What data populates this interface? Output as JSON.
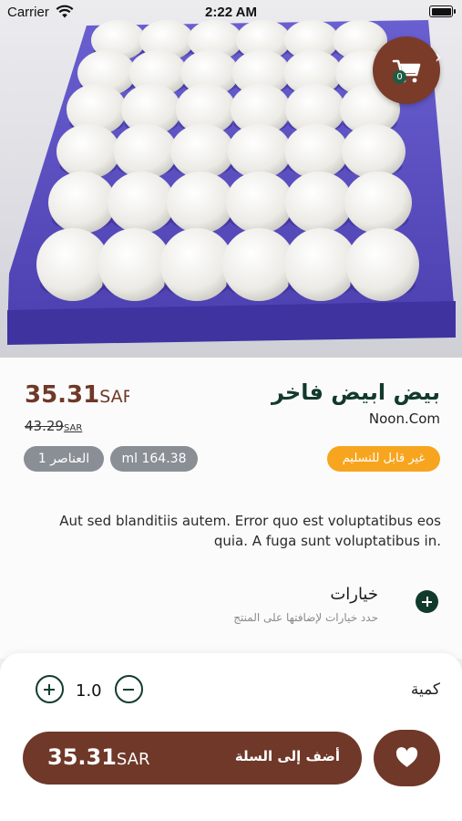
{
  "status_bar": {
    "carrier": "Carrier",
    "time": "2:22 AM"
  },
  "cart": {
    "count": "0"
  },
  "product": {
    "title": "بيض ابيض فاخر",
    "seller": "Noon.Com",
    "price": "35.31",
    "old_price": "43.29",
    "currency": "SAR",
    "delivery_badge": "غير قابل للتسليم",
    "weight_chip": "ml 164.38",
    "count_chip": "1 العناصر",
    "description": "Aut sed blanditiis autem. Error quo est voluptatibus eos quia. A fuga sunt voluptatibus in."
  },
  "options": {
    "title": "خيارات",
    "subtitle": "حدد خيارات لإضافتها على المنتج"
  },
  "quantity": {
    "label": "كمية",
    "value": "1.0"
  },
  "add_to_cart": {
    "label": "أضف إلى السلة",
    "price": "35.31",
    "currency": "SAR"
  },
  "colors": {
    "brand_brown": "#6f3828",
    "brand_green": "#123a2c",
    "badge_orange": "#f7a51f",
    "chip_gray": "#8a8f95"
  }
}
